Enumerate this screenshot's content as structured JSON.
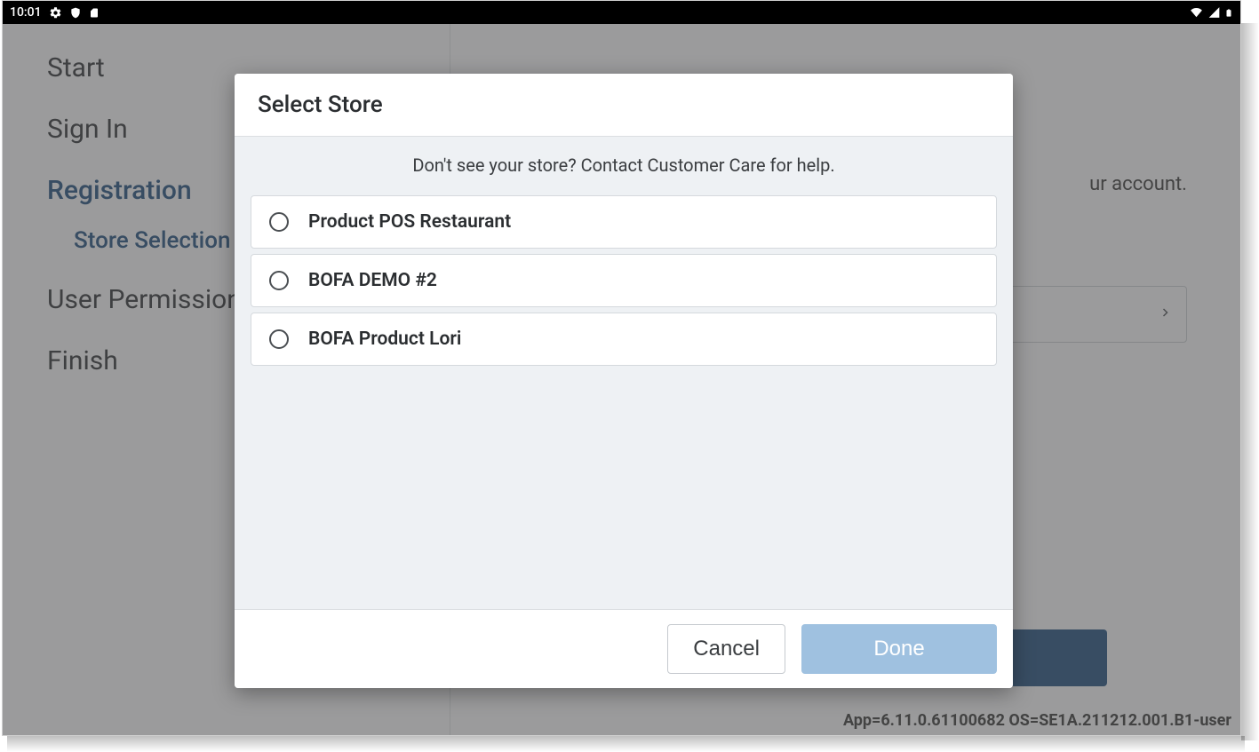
{
  "statusbar": {
    "time": "10:01"
  },
  "sidebar": {
    "steps": [
      {
        "label": "Start",
        "active": false
      },
      {
        "label": "Sign In",
        "active": false
      },
      {
        "label": "Registration",
        "active": true
      },
      {
        "label": "User Permissions",
        "active": false
      },
      {
        "label": "Finish",
        "active": false
      }
    ],
    "substep": "Store Selection"
  },
  "main": {
    "hint_suffix": "ur account."
  },
  "dialog": {
    "title": "Select Store",
    "help_text": "Don't see your store? Contact Customer Care for help.",
    "stores": [
      {
        "name": "Product POS Restaurant"
      },
      {
        "name": "BOFA DEMO #2"
      },
      {
        "name": "BOFA Product Lori"
      }
    ],
    "cancel_label": "Cancel",
    "done_label": "Done"
  },
  "footer": {
    "version": "App=6.11.0.61100682 OS=SE1A.211212.001.B1-user"
  }
}
